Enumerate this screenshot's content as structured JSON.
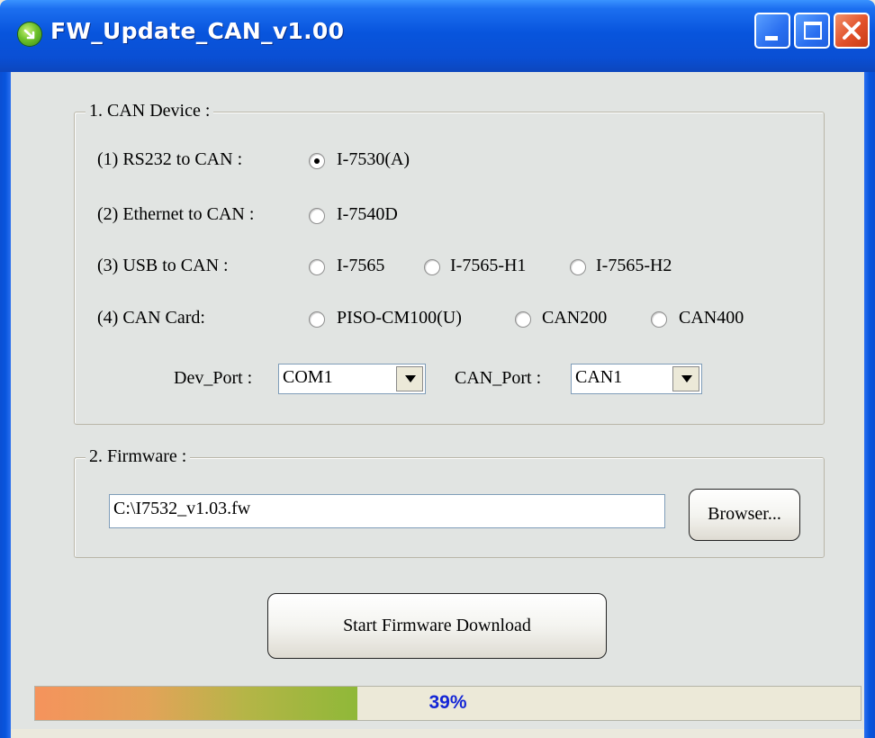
{
  "window": {
    "title": "FW_Update_CAN_v1.00"
  },
  "colors": {
    "titlebar": "#0855dd",
    "client": "#e1e4e2",
    "progress_text": "#1426d6"
  },
  "can_device": {
    "legend": "1. CAN Device :",
    "rows": [
      {
        "label": "(1) RS232 to CAN :",
        "options": [
          {
            "label": "I-7530(A)",
            "checked": true
          }
        ]
      },
      {
        "label": "(2) Ethernet to CAN :",
        "options": [
          {
            "label": "I-7540D",
            "checked": false
          }
        ]
      },
      {
        "label": "(3) USB to CAN :",
        "options": [
          {
            "label": "I-7565",
            "checked": false
          },
          {
            "label": "I-7565-H1",
            "checked": false
          },
          {
            "label": "I-7565-H2",
            "checked": false
          }
        ]
      },
      {
        "label": "(4) CAN Card:",
        "options": [
          {
            "label": "PISO-CM100(U)",
            "checked": false
          },
          {
            "label": "CAN200",
            "checked": false
          },
          {
            "label": "CAN400",
            "checked": false
          }
        ]
      }
    ],
    "dev_port": {
      "label": "Dev_Port :",
      "value": "COM1"
    },
    "can_port": {
      "label": "CAN_Port :",
      "value": "CAN1"
    }
  },
  "firmware": {
    "legend": "2. Firmware :",
    "path": "C:\\I7532_v1.03.fw",
    "browse_label": "Browser..."
  },
  "start_button": "Start Firmware Download",
  "progress": {
    "value": 0.39,
    "text": "39%"
  }
}
